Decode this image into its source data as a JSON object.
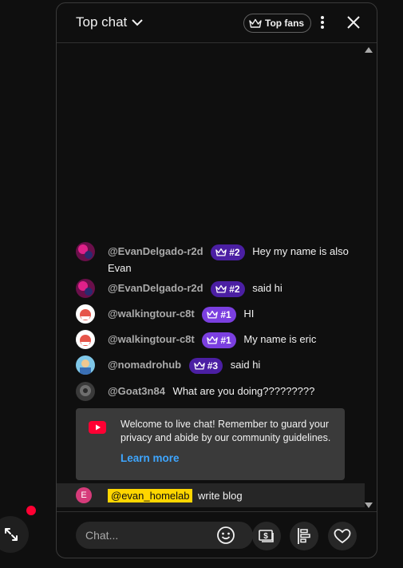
{
  "header": {
    "title": "Top chat",
    "top_fans_label": "Top fans"
  },
  "messages": [
    {
      "author": "@EvanDelgado-r2d",
      "badge": "#2",
      "text": "Hey my name is also Evan"
    },
    {
      "author": "@EvanDelgado-r2d",
      "badge": "#2",
      "text": "said hi"
    },
    {
      "author": "@walkingtour-c8t",
      "badge": "#1",
      "text": "HI"
    },
    {
      "author": "@walkingtour-c8t",
      "badge": "#1",
      "text": "My name is eric"
    },
    {
      "author": "@nomadrohub",
      "badge": "#3",
      "text": "said hi"
    },
    {
      "author": "@Goat3n84",
      "badge": "",
      "text": "What are you doing?????????"
    }
  ],
  "welcome": {
    "text": "Welcome to live chat! Remember to guard your privacy and abide by our community guidelines.",
    "learn_more": "Learn more"
  },
  "my_message": {
    "avatar_letter": "E",
    "mention": "@evan_homelab",
    "text": "write blog"
  },
  "input": {
    "placeholder": "Chat..."
  },
  "colors": {
    "accent_link": "#3ea6ff",
    "badge_dark": "#4b1fa3",
    "badge_light": "#7b3fe0",
    "mention_bg": "#ffd600",
    "live_dot": "#ff0033"
  }
}
